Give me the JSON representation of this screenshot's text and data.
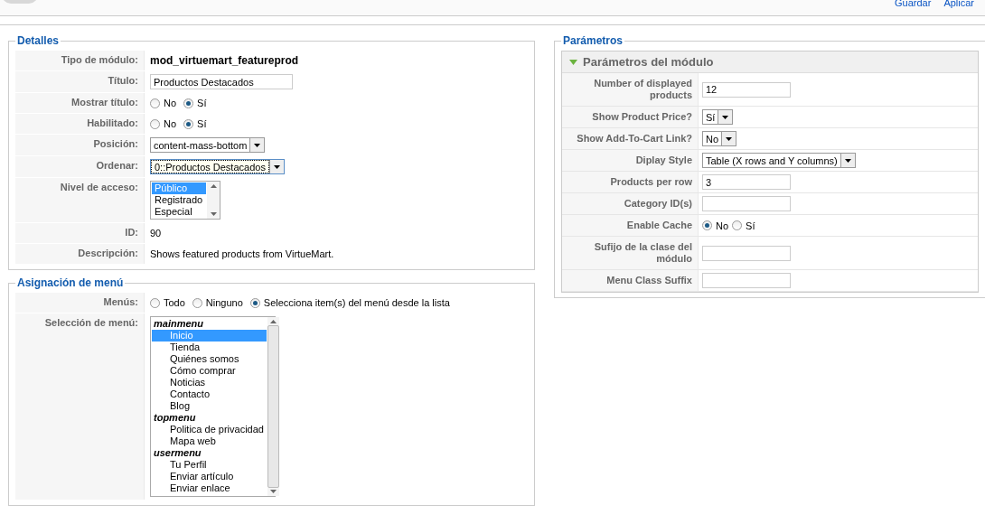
{
  "toolbar": {
    "buttons": [
      "Guardar",
      "Aplicar"
    ]
  },
  "details": {
    "legend": "Detalles",
    "rows": [
      {
        "label": "Tipo de módulo:",
        "kind": "bold_text",
        "value": "mod_virtuemart_featureprod"
      },
      {
        "label": "Título:",
        "kind": "input",
        "value": "Productos Destacados"
      },
      {
        "label": "Mostrar título:",
        "kind": "radio",
        "options": [
          {
            "label": "No",
            "selected": false
          },
          {
            "label": "Sí",
            "selected": true
          }
        ]
      },
      {
        "label": "Habilitado:",
        "kind": "radio",
        "options": [
          {
            "label": "No",
            "selected": false
          },
          {
            "label": "Sí",
            "selected": true
          }
        ]
      },
      {
        "label": "Posición:",
        "kind": "select",
        "value": "content-mass-bottom",
        "focused": false
      },
      {
        "label": "Ordenar:",
        "kind": "select",
        "value": "0::Productos Destacados",
        "focused": true
      },
      {
        "label": "Nivel de acceso:",
        "kind": "listbox",
        "items": [
          {
            "label": "Público",
            "selected": true
          },
          {
            "label": "Registrado",
            "selected": false
          },
          {
            "label": "Especial",
            "selected": false
          }
        ]
      },
      {
        "label": "ID:",
        "kind": "text",
        "value": "90"
      },
      {
        "label": "Descripción:",
        "kind": "text",
        "value": "Shows featured products from VirtueMart."
      }
    ]
  },
  "menu_assignment": {
    "legend": "Asignación de menú",
    "rows": [
      {
        "label": "Menús:",
        "kind": "radio",
        "options": [
          {
            "label": "Todo",
            "selected": false
          },
          {
            "label": "Ninguno",
            "selected": false
          },
          {
            "label": "Selecciona item(s) del menú desde la lista",
            "selected": true
          }
        ]
      },
      {
        "label": "Selección de menú:",
        "kind": "menu_list",
        "groups": [
          {
            "name": "mainmenu",
            "items": [
              {
                "label": "Inicio",
                "selected": true
              },
              {
                "label": "Tienda",
                "selected": false
              },
              {
                "label": "Quiénes somos",
                "selected": false
              },
              {
                "label": "Cómo comprar",
                "selected": false
              },
              {
                "label": "Noticias",
                "selected": false
              },
              {
                "label": "Contacto",
                "selected": false
              },
              {
                "label": "Blog",
                "selected": false
              }
            ]
          },
          {
            "name": "topmenu",
            "items": [
              {
                "label": "Politica de privacidad",
                "selected": false
              },
              {
                "label": "Mapa web",
                "selected": false
              }
            ]
          },
          {
            "name": "usermenu",
            "items": [
              {
                "label": "Tu Perfil",
                "selected": false
              },
              {
                "label": "Enviar artículo",
                "selected": false
              },
              {
                "label": "Enviar enlace",
                "selected": false
              }
            ]
          }
        ]
      }
    ]
  },
  "parameters": {
    "legend": "Parámetros",
    "panel": {
      "title": "Parámetros del módulo",
      "expanded": true
    },
    "rows": [
      {
        "label": "Number of displayed products",
        "kind": "input",
        "value": "12"
      },
      {
        "label": "Show Product Price?",
        "kind": "select",
        "value": "Sí",
        "focused": false
      },
      {
        "label": "Show Add-To-Cart Link?",
        "kind": "select",
        "value": "No",
        "focused": false
      },
      {
        "label": "Diplay Style",
        "kind": "select",
        "value": "Table (X rows and Y columns)",
        "focused": false
      },
      {
        "label": "Products per row",
        "kind": "input",
        "value": "3"
      },
      {
        "label": "Category ID(s)",
        "kind": "input"
      },
      {
        "label": "Enable Cache",
        "kind": "radio",
        "options": [
          {
            "label": "No",
            "selected": true
          },
          {
            "label": "Sí",
            "selected": false
          }
        ]
      },
      {
        "label": "Sufijo de la clase del módulo",
        "kind": "input"
      },
      {
        "label": "Menu Class Suffix",
        "kind": "input"
      }
    ]
  }
}
